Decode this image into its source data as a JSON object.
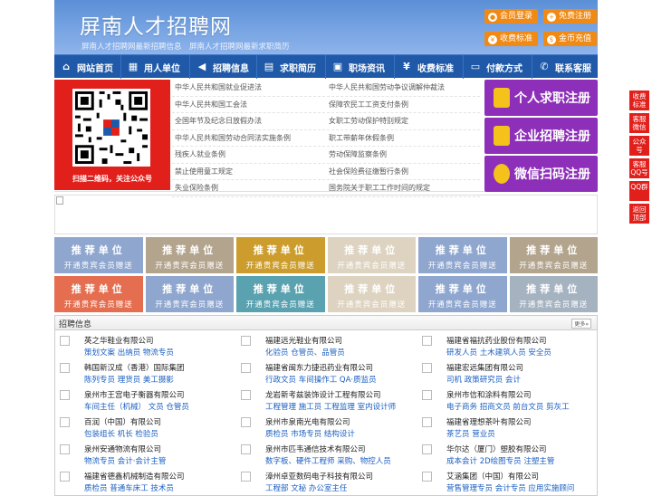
{
  "header": {
    "title": "屏南人才招聘网",
    "subtitle": "屏南人才招聘网最新招聘信息　屏南人才招聘网最新求职简历",
    "buttons": [
      {
        "label": "会员登录",
        "icon": "user-icon"
      },
      {
        "label": "免费注册",
        "icon": "user-plus-icon"
      },
      {
        "label": "收费标准",
        "icon": "yen-icon"
      },
      {
        "label": "金币充值",
        "icon": "coin-icon"
      }
    ]
  },
  "nav": [
    {
      "label": "网站首页",
      "icon": "home-icon"
    },
    {
      "label": "用人单位",
      "icon": "building-icon"
    },
    {
      "label": "招聘信息",
      "icon": "megaphone-icon"
    },
    {
      "label": "求职简历",
      "icon": "resume-icon"
    },
    {
      "label": "职场资讯",
      "icon": "news-icon"
    },
    {
      "label": "收费标准",
      "icon": "yen-icon"
    },
    {
      "label": "付款方式",
      "icon": "card-icon"
    },
    {
      "label": "联系客服",
      "icon": "phone-icon"
    }
  ],
  "qr_caption": "扫描二维码，关注公众号",
  "laws": [
    [
      "中华人民共和国就业促进法",
      "中华人民共和国劳动争议调解仲裁法"
    ],
    [
      "中华人民共和国工会法",
      "保障农民工工资支付条例"
    ],
    [
      "全国年节及纪念日放假办法",
      "女职工劳动保护特别规定"
    ],
    [
      "中华人民共和国劳动合同法实施条例",
      "职工带薪年休假条例"
    ],
    [
      "残疾人就业条例",
      "劳动保障监察条例"
    ],
    [
      "禁止使用童工规定",
      "社会保险费征缴暂行条例"
    ],
    [
      "失业保险条例",
      "国务院关于职工工作时间的规定"
    ]
  ],
  "register": [
    {
      "label": "个人求职注册",
      "color": "#8e2fb9"
    },
    {
      "label": "企业招聘注册",
      "color": "#8e2fb9"
    },
    {
      "label": "微信扫码注册",
      "color": "#8e2fb9"
    }
  ],
  "tiles": {
    "line1": "推荐单位",
    "line2": "开通贵宾会员赠送",
    "colors": [
      [
        "#8fa6cf",
        "#b3a48e",
        "#cc9d2c",
        "#ddd3c0",
        "#8fa6cf",
        "#b3a48e"
      ],
      [
        "#e46e4f",
        "#8fa6cf",
        "#5aa2b0",
        "#ddd3c0",
        "#8fa6cf",
        "#a5b3c0"
      ]
    ]
  },
  "jobs_section": {
    "title": "招聘信息",
    "more": "更多»"
  },
  "jobs": [
    {
      "company": "英之华鞋业有限公司",
      "posts": "策划文案 出纳员 物流专员"
    },
    {
      "company": "福建远光鞋业有限公司",
      "posts": "化验员 仓管员、品管员"
    },
    {
      "company": "福建省福抗药业股份有限公司",
      "posts": "研发人员 土木建筑人员 安全员"
    },
    {
      "company": "韩国新汉成（香港）国际集团",
      "posts": "陈列专员 理货员 美工摄影"
    },
    {
      "company": "福建省闽东力捷迅药业有限公司",
      "posts": "行政文员 车间操作工 QA·质监员"
    },
    {
      "company": "福建宏远集团有限公司",
      "posts": "司机 政策研究员 会计"
    },
    {
      "company": "泉州市王宫电子衡器有限公司",
      "posts": "车间主任（机械） 文员 仓管员"
    },
    {
      "company": "龙岩新考兹装饰设计工程有限公司",
      "posts": "工程管理 施工员 工程监理 室内设计师"
    },
    {
      "company": "泉州市信和涂料有限公司",
      "posts": "电子商务 招商文员 前台文员 剪灰工"
    },
    {
      "company": "百润（中国）有限公司",
      "posts": "包装组长 机长 检验员"
    },
    {
      "company": "泉州市泉南光电有限公司",
      "posts": "质检员 市场专员 结构设计"
    },
    {
      "company": "福建省理想茶叶有限公司",
      "posts": "茶艺员 营业员"
    },
    {
      "company": "泉州安通物流有限公司",
      "posts": "物流专员 会计·会计主管"
    },
    {
      "company": "泉州市匹韦通信技术有限公司",
      "posts": "数字板、硬件工程师 采购、物控人员"
    },
    {
      "company": "华尔达（厦门）塑胶有限公司",
      "posts": "成本会计 2D绘图专员 注塑主管"
    },
    {
      "company": "福建省德鑫机械制造有限公司",
      "posts": "质检员 普通车床工 技术员"
    },
    {
      "company": "漳州卓亚数码电子科技有限公司",
      "posts": "工程部 文秘 办公室主任"
    },
    {
      "company": "艾涵集团（中国）有限公司",
      "posts": "营售管理专员 会计专员 应用实施顾问"
    }
  ],
  "sidebar": [
    {
      "label": "收费标准",
      "color": "#e11f1b"
    },
    {
      "label": "客服微信",
      "color": "#e11f1b"
    },
    {
      "label": "公众号",
      "color": "#e11f1b"
    },
    {
      "label": "客服QQ号",
      "color": "#e11f1b"
    },
    {
      "label": "QQ群",
      "color": "#e11f1b"
    },
    {
      "label": "返回顶部",
      "color": "#e11f1b"
    }
  ]
}
